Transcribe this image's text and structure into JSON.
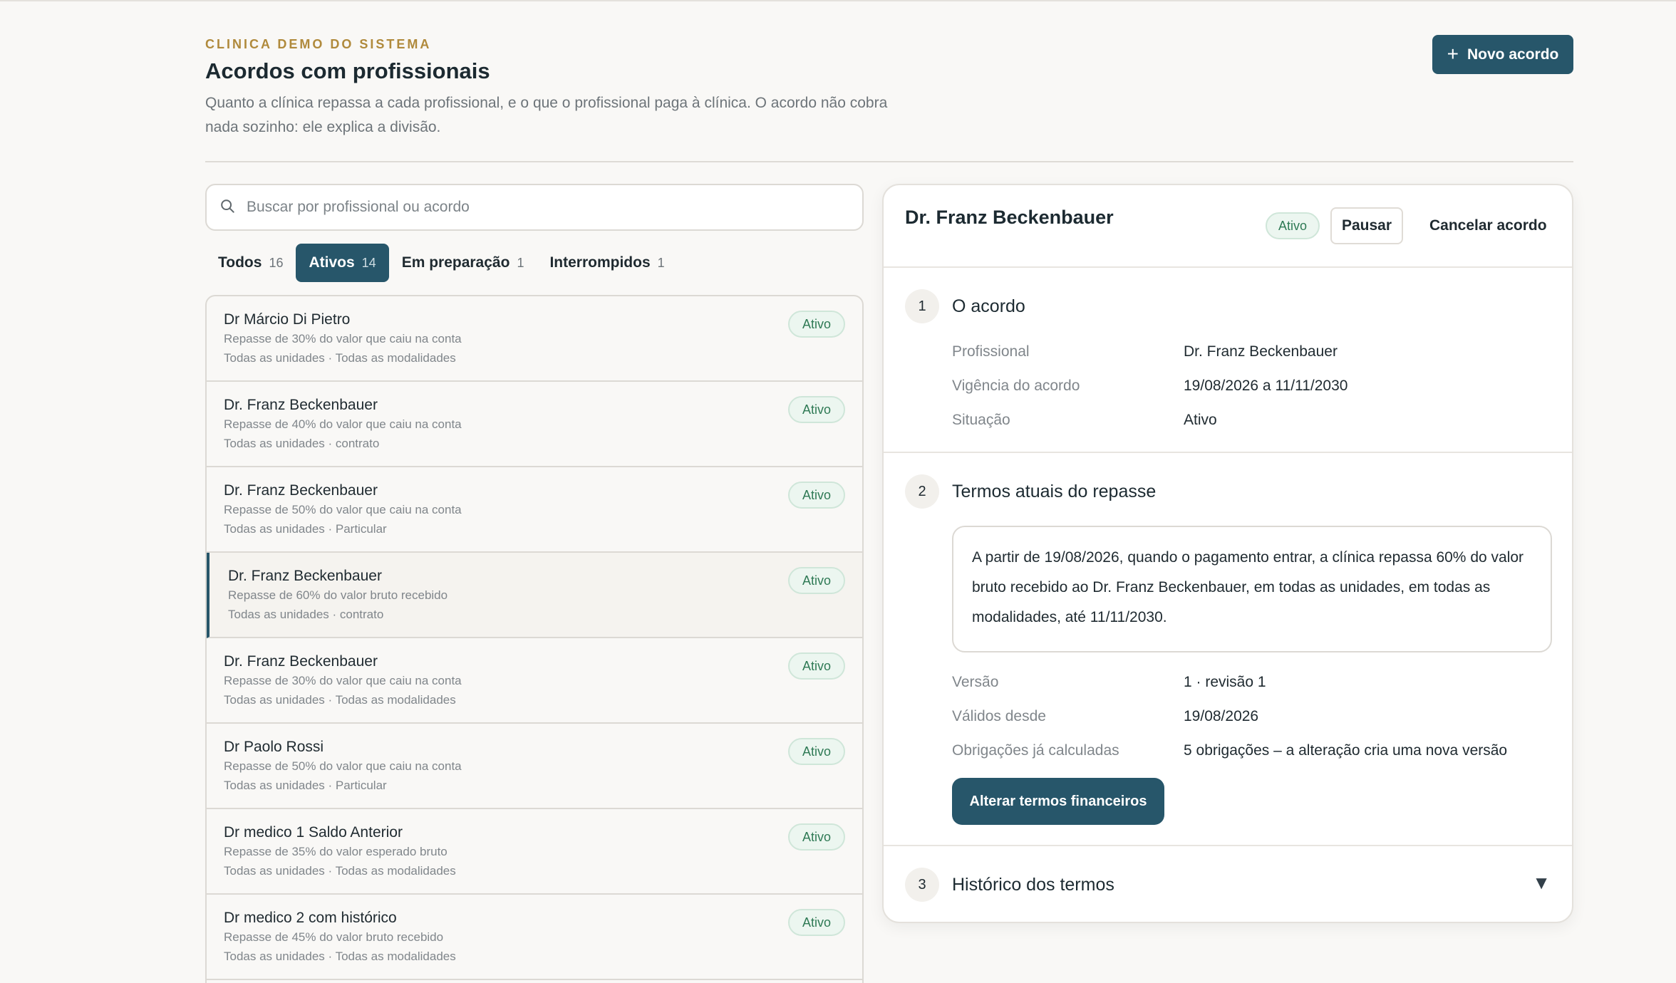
{
  "header": {
    "eyebrow": "CLINICA DEMO DO SISTEMA",
    "title": "Acordos com profissionais",
    "description": "Quanto a clínica repassa a cada profissional, e o que o profissional paga à clínica. O acordo não cobra nada sozinho: ele explica a divisão.",
    "new_button": "Novo acordo",
    "new_button_icon": "plus-icon"
  },
  "search": {
    "placeholder": "Buscar por profissional ou acordo",
    "value": "",
    "icon": "search-icon"
  },
  "tabs": [
    {
      "label": "Todos",
      "count": "16",
      "active": false
    },
    {
      "label": "Ativos",
      "count": "14",
      "active": true
    },
    {
      "label": "Em preparação",
      "count": "1",
      "active": false
    },
    {
      "label": "Interrompidos",
      "count": "1",
      "active": false
    }
  ],
  "agreements": [
    {
      "name": "Dr Márcio Di Pietro",
      "terms": "Repasse de 30% do valor que caiu na conta",
      "scope": "Todas as unidades · Todas as modalidades",
      "status": "Ativo"
    },
    {
      "name": "Dr. Franz Beckenbauer",
      "terms": "Repasse de 40% do valor que caiu na conta",
      "scope": "Todas as unidades · contrato",
      "status": "Ativo"
    },
    {
      "name": "Dr. Franz Beckenbauer",
      "terms": "Repasse de 50% do valor que caiu na conta",
      "scope": "Todas as unidades · Particular",
      "status": "Ativo"
    },
    {
      "name": "Dr. Franz Beckenbauer",
      "terms": "Repasse de 60% do valor bruto recebido",
      "scope": "Todas as unidades · contrato",
      "status": "Ativo",
      "selected": true
    },
    {
      "name": "Dr. Franz Beckenbauer",
      "terms": "Repasse de 30% do valor que caiu na conta",
      "scope": "Todas as unidades · Todas as modalidades",
      "status": "Ativo"
    },
    {
      "name": "Dr Paolo Rossi",
      "terms": "Repasse de 50% do valor que caiu na conta",
      "scope": "Todas as unidades · Particular",
      "status": "Ativo"
    },
    {
      "name": "Dr medico 1 Saldo Anterior",
      "terms": "Repasse de 35% do valor esperado bruto",
      "scope": "Todas as unidades · Todas as modalidades",
      "status": "Ativo"
    },
    {
      "name": "Dr medico 2 com histórico",
      "terms": "Repasse de 45% do valor bruto recebido",
      "scope": "Todas as unidades · Todas as modalidades",
      "status": "Ativo"
    }
  ],
  "detail": {
    "title": "Dr. Franz Beckenbauer",
    "status": "Ativo",
    "pause_button": "Pausar",
    "cancel_button": "Cancelar acordo",
    "section1": {
      "step": "1",
      "title": "O acordo",
      "rows": [
        {
          "key": "Profissional",
          "value": "Dr. Franz Beckenbauer"
        },
        {
          "key": "Vigência do acordo",
          "value": "19/08/2026 a 11/11/2030"
        },
        {
          "key": "Situação",
          "value": "Ativo"
        }
      ]
    },
    "section2": {
      "step": "2",
      "title": "Termos atuais do repasse",
      "summary": "A partir de 19/08/2026, quando o pagamento entrar, a clínica repassa 60% do valor bruto recebido ao Dr. Franz Beckenbauer, em todas as unidades, em todas as modalidades, até 11/11/2030.",
      "rows": [
        {
          "key": "Versão",
          "value": "1 · revisão 1"
        },
        {
          "key": "Válidos desde",
          "value": "19/08/2026"
        },
        {
          "key": "Obrigações já calculadas",
          "value": "5 obrigações – a alteração cria uma nova versão"
        }
      ],
      "alter_button": "Alterar termos financeiros"
    },
    "section3": {
      "step": "3",
      "title": "Histórico dos termos",
      "toggle_icon": "triangle-down-icon",
      "toggle_glyph": "▼"
    }
  },
  "colors": {
    "accent": "#27566a",
    "eyebrow": "#b08a3c",
    "badge_text": "#2f7a55",
    "badge_bg": "#ecf6f0"
  }
}
